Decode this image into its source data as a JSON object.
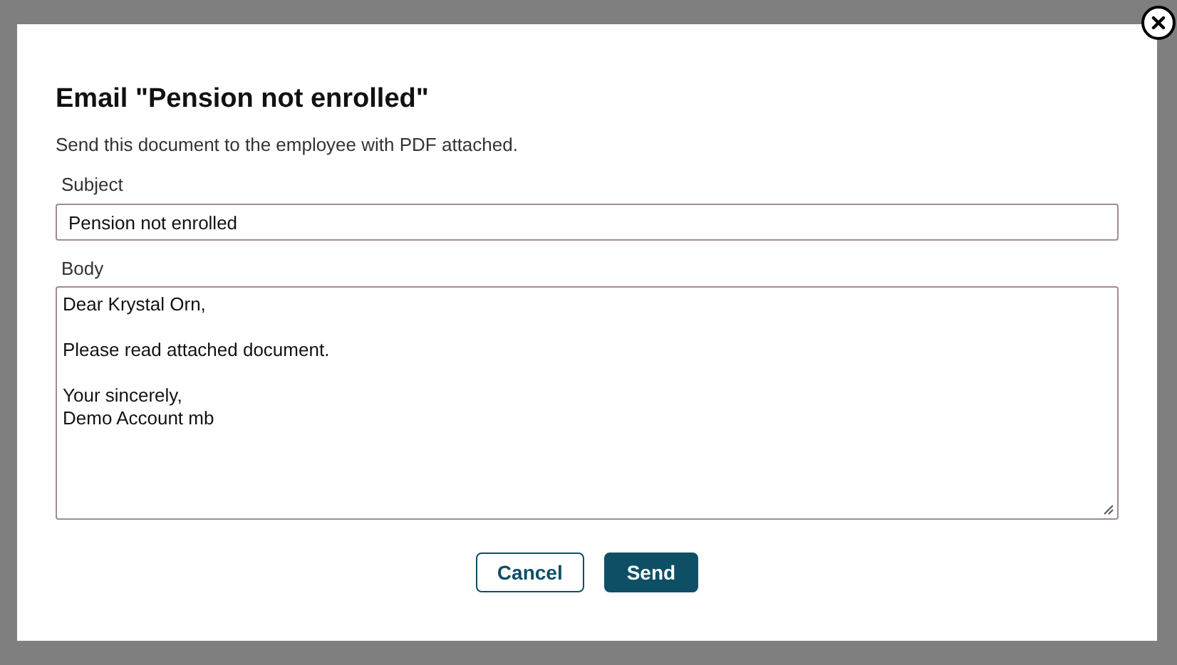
{
  "dialog": {
    "title": "Email \"Pension not enrolled\"",
    "description": "Send this document to the employee with PDF attached.",
    "subject": {
      "label": "Subject",
      "value": "Pension not enrolled"
    },
    "body": {
      "label": "Body",
      "value": "Dear Krystal Orn,\n\nPlease read attached document.\n\nYour sincerely,\nDemo Account mb"
    },
    "buttons": [
      {
        "label": "Cancel",
        "kind": "secondary"
      },
      {
        "label": "Send",
        "kind": "primary"
      }
    ]
  }
}
